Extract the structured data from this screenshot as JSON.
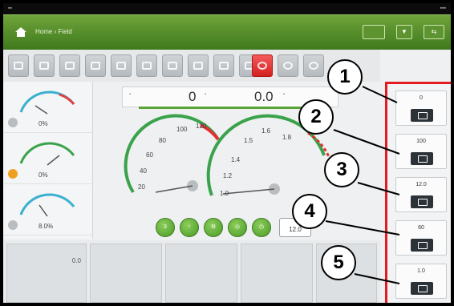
{
  "header": {
    "crumb": "Home › Field",
    "btn_a": "",
    "btn_b": ""
  },
  "readout": {
    "left_value": "0",
    "right_value": "0.0"
  },
  "left_gauges": [
    {
      "value": "0%"
    },
    {
      "value": "0%"
    },
    {
      "value": "8.0%"
    }
  ],
  "gauge_left": {
    "ticks": [
      "20",
      "40",
      "60",
      "80",
      "100",
      "120"
    ]
  },
  "gauge_right": {
    "ticks": [
      "1.0",
      "1.2",
      "1.4",
      "1.5",
      "1.6",
      "1.8"
    ]
  },
  "mode_buttons": [
    {
      "label": "3",
      "icon": "speed-icon"
    },
    {
      "label": "",
      "icon": "up-arrow-icon"
    },
    {
      "label": "",
      "icon": "gear-icon"
    },
    {
      "label": "",
      "icon": "target-icon"
    },
    {
      "label": "",
      "icon": "timer-icon"
    }
  ],
  "mode_box_value": "12.0",
  "bottom_value": "0.0",
  "slots": [
    {
      "value": "0"
    },
    {
      "value": "100"
    },
    {
      "value": "12.0"
    },
    {
      "value": "60"
    },
    {
      "value": "1.0"
    }
  ],
  "callouts": [
    "1",
    "2",
    "3",
    "4",
    "5"
  ],
  "colors": {
    "header": "#3f7a1d",
    "highlight": "#e31b23",
    "accent": "#5aa435"
  }
}
